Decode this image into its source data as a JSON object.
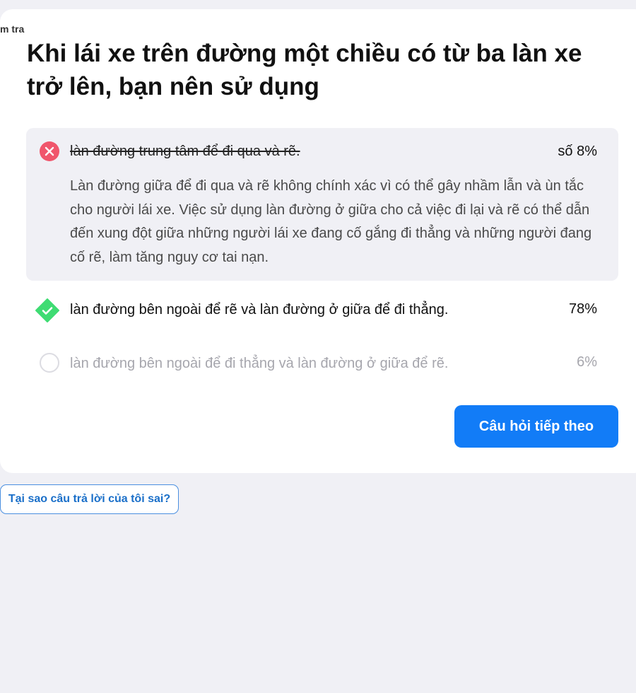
{
  "breadcrumb": "m tra",
  "question": "Khi lái xe trên đường một chiều có từ ba làn xe trở lên, bạn nên sử dụng",
  "options": [
    {
      "text": "làn đường trung tâm để đi qua và rẽ.",
      "percent": "số 8%",
      "state": "wrong",
      "explanation": "Làn đường giữa để đi qua và rẽ không chính xác vì có thể gây nhầm lẫn và ùn tắc cho người lái xe. Việc sử dụng làn đường ở giữa cho cả việc đi lại và rẽ có thể dẫn đến xung đột giữa những người lái xe đang cố gắng đi thẳng và những người đang cố rẽ, làm tăng nguy cơ tai nạn."
    },
    {
      "text": "làn đường bên ngoài để rẽ và làn đường ở giữa để đi thẳng.",
      "percent": "78%",
      "state": "correct"
    },
    {
      "text": "làn đường bên ngoài để đi thẳng và làn đường ở giữa để rẽ.",
      "percent": "6%",
      "state": "unselected"
    }
  ],
  "next_button": "Câu hỏi tiếp theo",
  "why_button": "Tại sao câu trả lời của tôi sai?",
  "colors": {
    "wrong": "#f0566c",
    "correct": "#3fdc73",
    "primary": "#127cf7"
  }
}
